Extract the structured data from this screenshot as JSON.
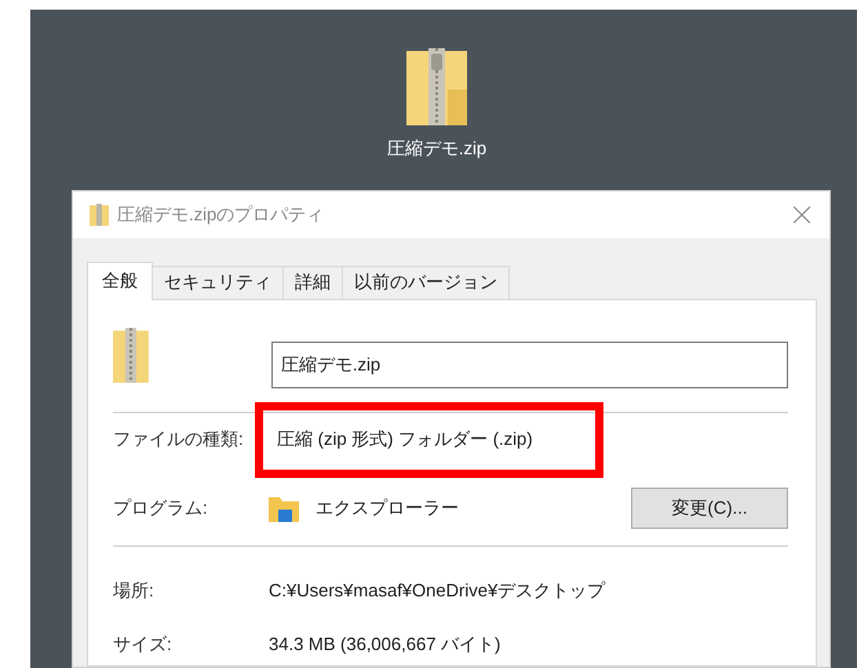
{
  "desktop_icon": {
    "label": "圧縮デモ.zip"
  },
  "window": {
    "title": "圧縮デモ.zipのプロパティ"
  },
  "tabs": [
    {
      "label": "全般",
      "selected": true
    },
    {
      "label": "セキュリティ",
      "selected": false
    },
    {
      "label": "詳細",
      "selected": false
    },
    {
      "label": "以前のバージョン",
      "selected": false
    }
  ],
  "name_field": {
    "value": "圧縮デモ.zip"
  },
  "file_type": {
    "label": "ファイルの種類:",
    "value": "圧縮 (zip 形式) フォルダー (.zip)",
    "highlighted": true
  },
  "program": {
    "label": "プログラム:",
    "value": "エクスプローラー",
    "button": "変更(C)..."
  },
  "location": {
    "label": "場所:",
    "value": "C:¥Users¥masaf¥OneDrive¥デスクトップ"
  },
  "size": {
    "label": "サイズ:",
    "value": "34.3 MB (36,006,667 バイト)"
  }
}
